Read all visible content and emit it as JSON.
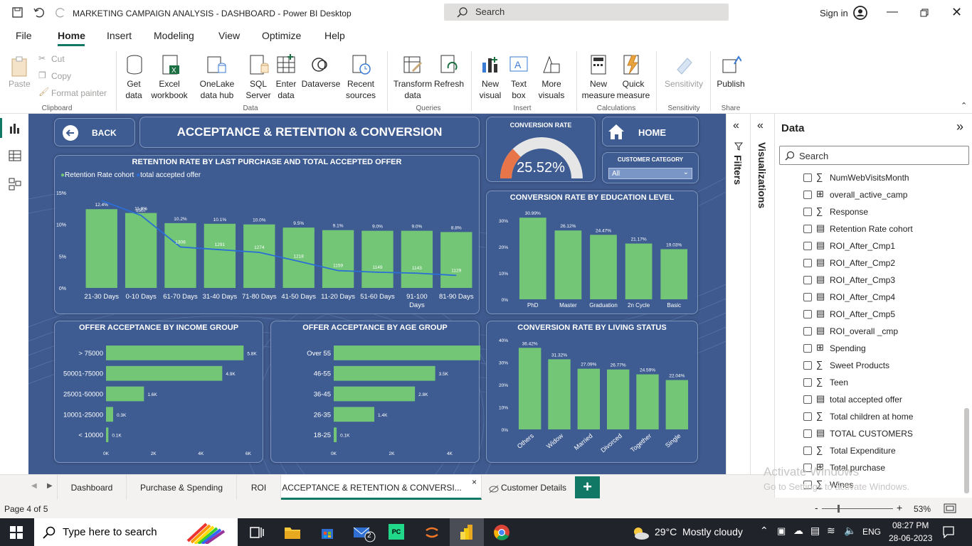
{
  "window": {
    "title": "MARKETING CAMPAIGN ANALYSIS - DASHBOARD - Power BI Desktop",
    "search": "Search",
    "signin": "Sign in"
  },
  "menu": [
    "File",
    "Home",
    "Insert",
    "Modeling",
    "View",
    "Optimize",
    "Help"
  ],
  "ribbon": {
    "paste": "Paste",
    "cut": "Cut",
    "copy": "Copy",
    "format_painter": "Format painter",
    "clipboard": "Clipboard",
    "get_data": "Get data",
    "excel": "Excel workbook",
    "onelake": "OneLake data hub",
    "sql": "SQL Server",
    "enter": "Enter data",
    "dataverse": "Dataverse",
    "recent": "Recent sources",
    "data": "Data",
    "transform": "Transform data",
    "refresh": "Refresh",
    "queries": "Queries",
    "new_visual": "New visual",
    "text_box": "Text box",
    "more_visuals": "More visuals",
    "insert": "Insert",
    "new_measure": "New measure",
    "quick_measure": "Quick measure",
    "calculations": "Calculations",
    "sensitivity": "Sensitivity",
    "sensitivity_grp": "Sensitivity",
    "publish": "Publish",
    "share": "Share"
  },
  "report": {
    "back": "BACK",
    "title": "ACCEPTANCE & RETENTION & CONVERSION",
    "home": "HOME",
    "conv_title": "CONVERSION RATE",
    "conv_value": "25.52%",
    "conv_fraction": 0.2552,
    "cust_cat_title": "CUSTOMER CATEGORY",
    "cust_cat_value": "All"
  },
  "chart_data": [
    {
      "type": "bar+line",
      "title": "RETENTION RATE BY LAST PURCHASE AND TOTAL ACCEPTED OFFER",
      "legend": [
        "Retention Rate cohort",
        "total accepted offer"
      ],
      "categories": [
        "21-30 Days",
        "0-10 Days",
        "61-70 Days",
        "31-40 Days",
        "71-80 Days",
        "41-50 Days",
        "11-20 Days",
        "51-60 Days",
        "91-100 Days",
        "81-90 Days"
      ],
      "bar_labels": [
        "12.4%",
        "11.8%",
        "10.2%",
        "10.1%",
        "10.0%",
        "9.5%",
        "9.1%",
        "9.0%",
        "9.0%",
        "8.8%"
      ],
      "bar_values": [
        12.4,
        11.8,
        10.2,
        10.1,
        10.0,
        9.5,
        9.1,
        9.0,
        9.0,
        8.8
      ],
      "line_values": [
        1600,
        1507,
        1308,
        1291,
        1274,
        1218,
        1159,
        1149,
        1143,
        1129
      ],
      "line_labels": [
        "",
        "1507",
        "1308",
        "1291",
        "1274",
        "1218",
        "1159",
        "1149",
        "1143",
        "1129"
      ],
      "yticks": [
        "15%",
        "10%",
        "5%",
        "0%"
      ],
      "ylim": [
        0,
        15
      ]
    },
    {
      "type": "bar",
      "title": "CONVERSION RATE BY EDUCATION LEVEL",
      "categories": [
        "PhD",
        "Master",
        "Graduation",
        "2n Cycle",
        "Basic"
      ],
      "labels": [
        "30.99%",
        "26.12%",
        "24.47%",
        "21.17%",
        "19.03%"
      ],
      "values": [
        30.99,
        26.12,
        24.47,
        21.17,
        19.03
      ],
      "yticks": [
        "30%",
        "20%",
        "10%",
        "0%"
      ],
      "ylim": [
        0,
        34
      ]
    },
    {
      "type": "hbar",
      "title": "OFFER ACCEPTANCE BY INCOME GROUP",
      "categories": [
        "> 75000",
        "50001-75000",
        "25001-50000",
        "10001-25000",
        "< 10000"
      ],
      "labels": [
        "5.8K",
        "4.9K",
        "1.6K",
        "0.3K",
        "0.1K"
      ],
      "values": [
        5.8,
        4.9,
        1.6,
        0.3,
        0.1
      ],
      "xticks": [
        "0K",
        "2K",
        "4K",
        "6K"
      ],
      "xlim": [
        0,
        6
      ]
    },
    {
      "type": "hbar",
      "title": "OFFER ACCEPTANCE BY AGE GROUP",
      "categories": [
        "Over 55",
        "46-55",
        "36-45",
        "26-35",
        "18-25"
      ],
      "labels": [
        "5.1K",
        "3.5K",
        "2.8K",
        "1.4K",
        "0.1K"
      ],
      "values": [
        5.1,
        3.5,
        2.8,
        1.4,
        0.1
      ],
      "xticks": [
        "0K",
        "2K",
        "4K"
      ],
      "xlim": [
        0,
        5.3
      ]
    },
    {
      "type": "bar",
      "title": "CONVERSION RATE BY LIVING STATUS",
      "categories": [
        "Others",
        "Widow",
        "Married",
        "Divorced",
        "Together",
        "Single"
      ],
      "labels": [
        "36.42%",
        "31.32%",
        "27.09%",
        "26.77%",
        "24.59%",
        "22.04%"
      ],
      "values": [
        36.42,
        31.32,
        27.09,
        26.77,
        24.59,
        22.04
      ],
      "yticks": [
        "40%",
        "30%",
        "20%",
        "10%",
        "0%"
      ],
      "ylim": [
        0,
        40
      ]
    }
  ],
  "panes": {
    "filters": "Filters",
    "visualizations": "Visualizations",
    "data": "Data",
    "search": "Search"
  },
  "fields": [
    "NumWebVisitsMonth",
    "overall_active_camp",
    "Response",
    "Retention Rate cohort",
    "ROI_After_Cmp1",
    "ROI_After_Cmp2",
    "ROI_After_Cmp3",
    "ROI_After_Cmp4",
    "ROI_After_Cmp5",
    "ROI_overall _cmp",
    "Spending",
    "Sweet Products",
    "Teen",
    "total accepted offer",
    "Total children at home",
    "TOTAL CUSTOMERS",
    "Total Expenditure",
    "Total purchase",
    "Wines"
  ],
  "field_icons": [
    "sigma",
    "table",
    "sigma",
    "calc",
    "calc",
    "calc",
    "calc",
    "calc",
    "calc",
    "calc",
    "table",
    "sigma",
    "sigma",
    "calc",
    "sigma",
    "calc",
    "sigma",
    "table",
    "sigma"
  ],
  "tabs": [
    "Dashboard",
    "Purchase & Spending",
    "ROI",
    "ACCEPTANCE & RETENTION & CONVERSI...",
    "Customer Details"
  ],
  "status": {
    "page": "Page 4 of 5",
    "zoom": "53%",
    "activate1": "Activate Windows",
    "activate2": "Go to Settings to activate Windows."
  },
  "taskbar": {
    "search": "Type here to search",
    "weather": "29°C  Mostly cloudy",
    "lang": "ENG",
    "time": "08:27 PM",
    "date": "28-06-2023",
    "mail_badge": "2"
  }
}
